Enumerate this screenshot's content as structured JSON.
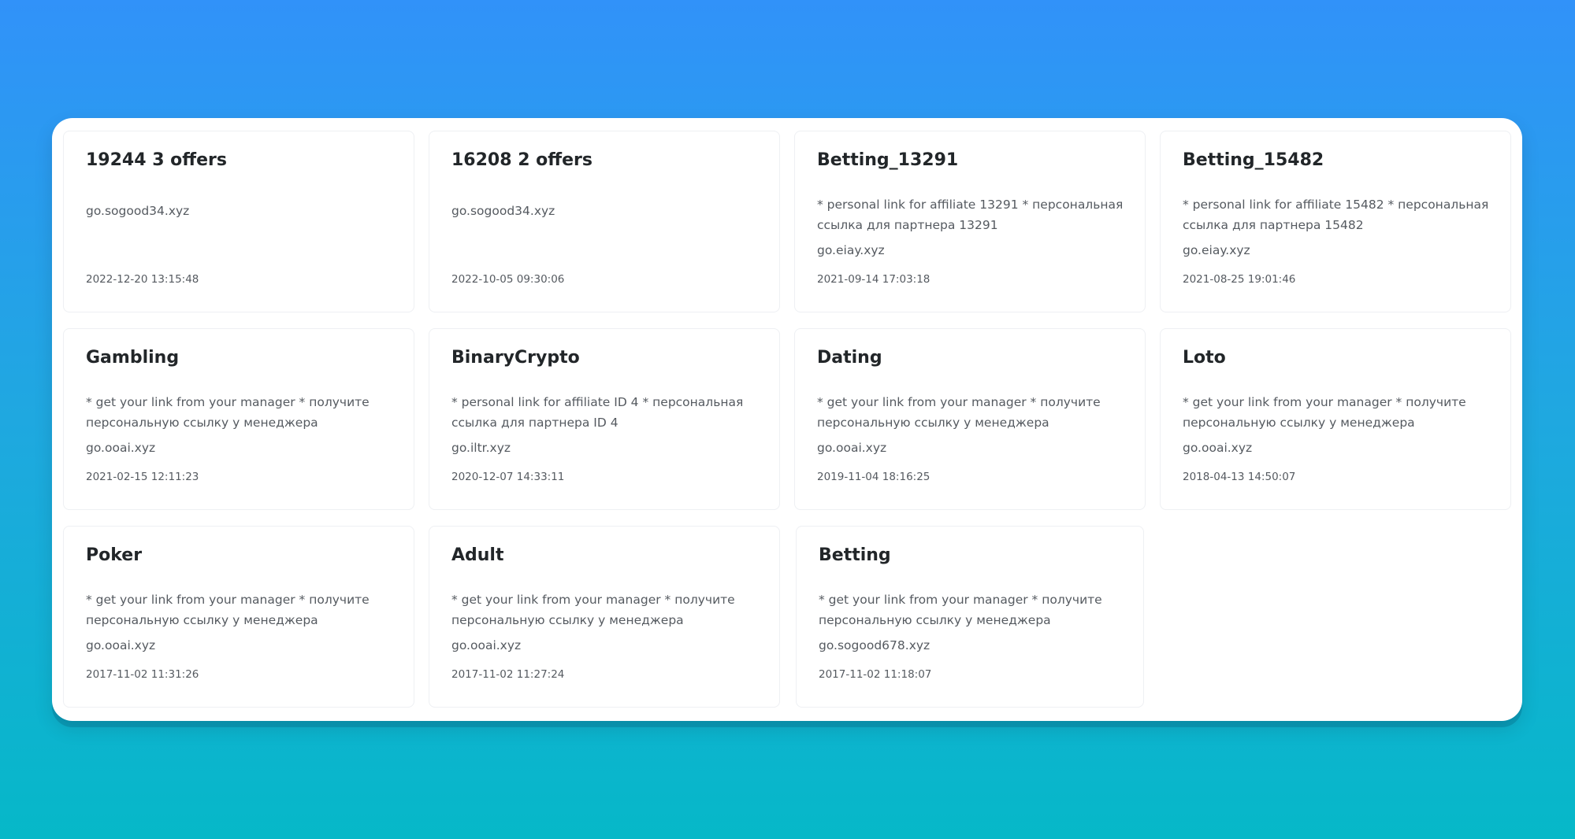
{
  "cards": [
    {
      "title": "19244 3 offers",
      "description": "",
      "domain": "go.sogood34.xyz",
      "date": "2022-12-20 13:15:48"
    },
    {
      "title": "16208 2 offers",
      "description": "",
      "domain": "go.sogood34.xyz",
      "date": "2022-10-05 09:30:06"
    },
    {
      "title": "Betting_13291",
      "description": "* personal link for affiliate 13291 * персональная ссылка для партнера 13291",
      "domain": "go.eiay.xyz",
      "date": "2021-09-14 17:03:18"
    },
    {
      "title": "Betting_15482",
      "description": "* personal link for affiliate 15482 * персональная ссылка для партнера 15482",
      "domain": "go.eiay.xyz",
      "date": "2021-08-25 19:01:46"
    },
    {
      "title": "Gambling",
      "description": "* get your link from your manager * получите персональную ссылку у менеджера",
      "domain": "go.ooai.xyz",
      "date": "2021-02-15 12:11:23"
    },
    {
      "title": "BinaryCrypto",
      "description": "* personal link for affiliate ID 4 * персональная ссылка для партнера ID 4",
      "domain": "go.iltr.xyz",
      "date": "2020-12-07 14:33:11"
    },
    {
      "title": "Dating",
      "description": "* get your link from your manager * получите персональную ссылку у менеджера",
      "domain": "go.ooai.xyz",
      "date": "2019-11-04 18:16:25"
    },
    {
      "title": "Loto",
      "description": "* get your link from your manager * получите персональную ссылку у менеджера",
      "domain": "go.ooai.xyz",
      "date": "2018-04-13 14:50:07"
    },
    {
      "title": "Poker",
      "description": "* get your link from your manager * получите персональную ссылку у менеджера",
      "domain": "go.ooai.xyz",
      "date": "2017-11-02 11:31:26"
    },
    {
      "title": "Adult",
      "description": "* get your link from your manager * получите персональную ссылку у менеджера",
      "domain": "go.ooai.xyz",
      "date": "2017-11-02 11:27:24"
    },
    {
      "title": "Betting",
      "description": "* get your link from your manager * получите персональную ссылку у менеджера",
      "domain": "go.sogood678.xyz",
      "date": "2017-11-02 11:18:07"
    }
  ]
}
